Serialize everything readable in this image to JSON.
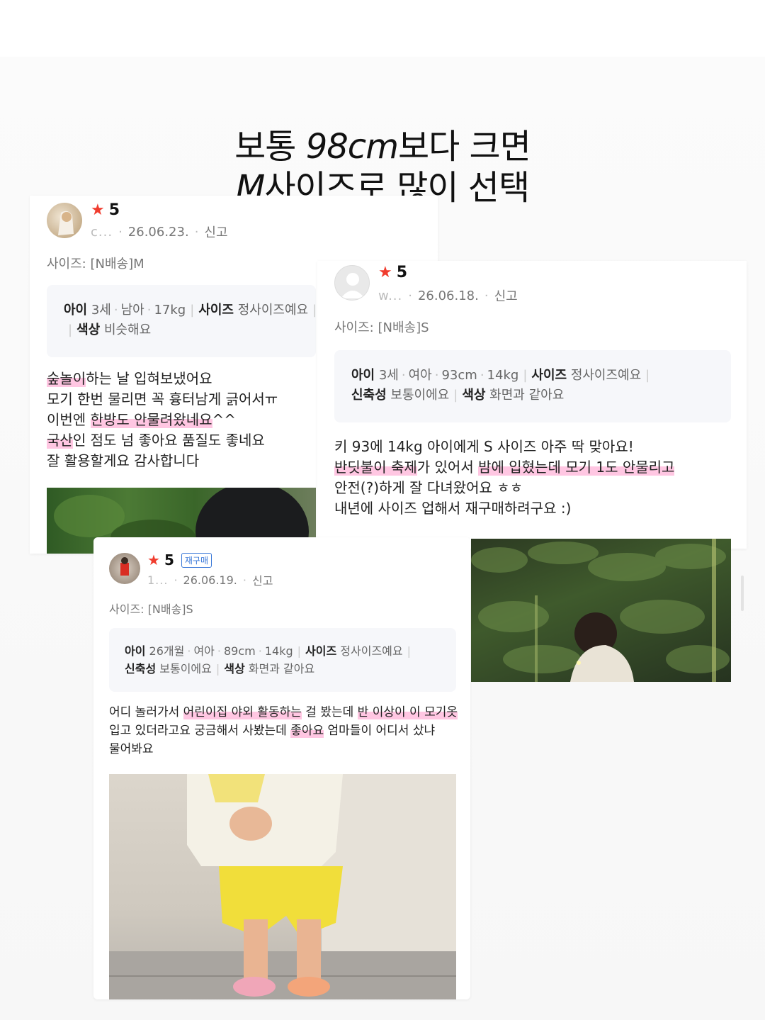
{
  "headline": {
    "line1_pre": "보통 ",
    "line1_em": "98cm",
    "line1_post": "보다 크면",
    "line2_em": "M",
    "line2_post": "사이즈로 많이 선택"
  },
  "review1": {
    "rating": "5",
    "author": "c...",
    "date": "26.06.23.",
    "report": "신고",
    "size": "사이즈: [N배송]M",
    "info": {
      "child_label": "아이",
      "age": "3세",
      "gender": "남아",
      "weight": "17kg",
      "size_label": "사이즈",
      "size_value": "정사이즈예요",
      "color_label": "색상",
      "color_value": "비슷해요"
    },
    "lines": [
      {
        "hl": "숲놀이",
        "rest": "하는 날 입혀보냈어요"
      },
      {
        "pre": "모기 한번 물리면 꼭 흉터남게 긁어서ㅠ"
      },
      {
        "pre": "이번엔 ",
        "hl": "한방도 안물려왔네요",
        "rest": "^^"
      },
      {
        "hl": "국산",
        "rest": "인 점도 넘 좋아요 품질도 좋네요"
      },
      {
        "pre": "잘 활용할게요 감사합니다"
      }
    ]
  },
  "review2": {
    "rating": "5",
    "author": "w...",
    "date": "26.06.18.",
    "report": "신고",
    "size": "사이즈: [N배송]S",
    "info": {
      "child_label": "아이",
      "age": "3세",
      "gender": "여아",
      "height": "93cm",
      "weight": "14kg",
      "size_label": "사이즈",
      "size_value": "정사이즈예요",
      "stretch_label": "신축성",
      "stretch_value": "보통이에요",
      "color_label": "색상",
      "color_value": "화면과 같아요"
    },
    "line1": "키 93에 14kg 아이에게 S 사이즈 아주 딱 맞아요!",
    "line2_hl1": "반딧불이 축제",
    "line2_mid": "가 있어서 ",
    "line2_hl2": "밤에 입혔는데 모기 1도 안물리고",
    "line3": "안전(?)하게 잘 다녀왔어요 ㅎㅎ",
    "line4": "내년에 사이즈 업해서 재구매하려구요 :)"
  },
  "review3": {
    "rating": "5",
    "badge": "재구매",
    "author": "1...",
    "date": "26.06.19.",
    "report": "신고",
    "size": "사이즈: [N배송]S",
    "info": {
      "child_label": "아이",
      "age": "26개월",
      "gender": "여아",
      "height": "89cm",
      "weight": "14kg",
      "size_label": "사이즈",
      "size_value": "정사이즈예요",
      "stretch_label": "신축성",
      "stretch_value": "보통이에요",
      "color_label": "색상",
      "color_value": "화면과 같아요"
    },
    "l1_pre": "어디 놀러가서 ",
    "l1_hl1": "어린이집 야외 활동하는",
    "l1_mid": " 걸 봤는데 ",
    "l1_hl2": "반 이상이 이 모기옷",
    "l2_pre": "입고 있더라고요 궁금해서 사봤는데 ",
    "l2_hl": "좋아요",
    "l2_post": " 엄마들이 어디서 샀냐",
    "l3": "물어봐요"
  },
  "colors": {
    "star": "#f03c2e",
    "highlight": "#ff82be",
    "badge": "#3a78d8"
  }
}
